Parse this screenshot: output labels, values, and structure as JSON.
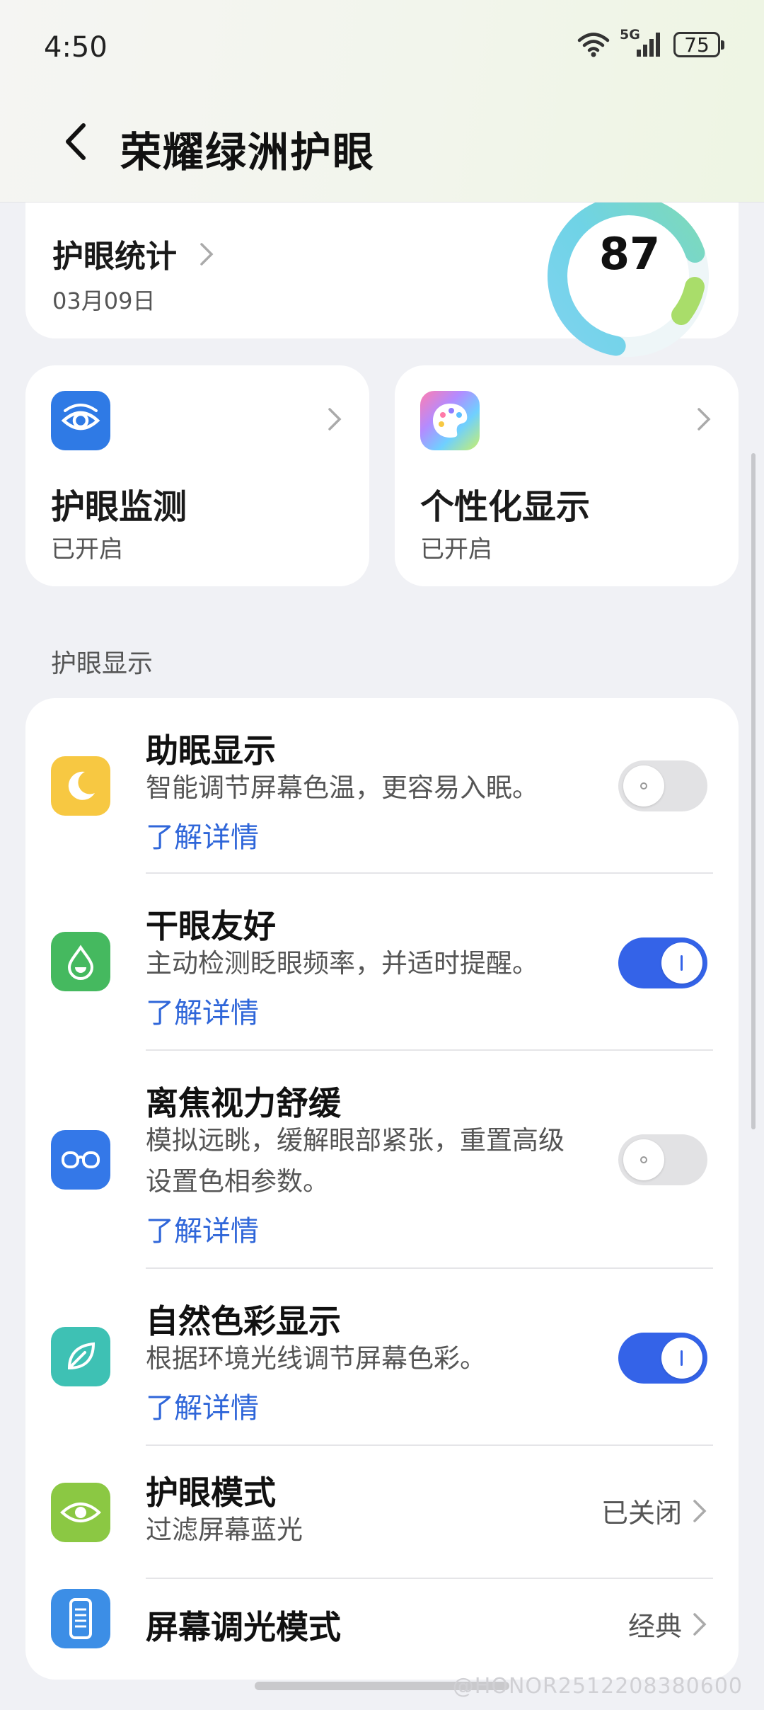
{
  "status_bar": {
    "time": "4:50",
    "network": "5G",
    "battery": "75"
  },
  "header": {
    "title": "荣耀绿洲护眼"
  },
  "stats": {
    "title": "护眼统计",
    "date": "03月09日",
    "score": "87"
  },
  "quick_cards": [
    {
      "title": "护眼监测",
      "status": "已开启",
      "icon": "eye-monitor-icon"
    },
    {
      "title": "个性化显示",
      "status": "已开启",
      "icon": "palette-icon"
    }
  ],
  "section_label": "护眼显示",
  "list": [
    {
      "title": "助眠显示",
      "desc": "智能调节屏幕色温，更容易入眠。",
      "link": "了解详情",
      "toggle": false,
      "icon": "moon-icon",
      "icon_color": "#f7c842"
    },
    {
      "title": "干眼友好",
      "desc": "主动检测眨眼频率，并适时提醒。",
      "link": "了解详情",
      "toggle": true,
      "icon": "water-drop-icon",
      "icon_color": "#45b95f"
    },
    {
      "title": "离焦视力舒缓",
      "desc": "模拟远眺，缓解眼部紧张，重置高级设置色相参数。",
      "link": "了解详情",
      "toggle": false,
      "icon": "glasses-icon",
      "icon_color": "#3478e8"
    },
    {
      "title": "自然色彩显示",
      "desc": "根据环境光线调节屏幕色彩。",
      "link": "了解详情",
      "toggle": true,
      "icon": "leaf-icon",
      "icon_color": "#3ec1b4"
    },
    {
      "title": "护眼模式",
      "desc": "过滤屏幕蓝光",
      "value": "已关闭",
      "icon": "eye-icon",
      "icon_color": "#8bc843"
    },
    {
      "title": "屏幕调光模式",
      "value": "经典",
      "icon": "screen-dimming-icon",
      "icon_color": "#3c8ee6"
    }
  ],
  "watermark": "@HONOR2512208380600"
}
